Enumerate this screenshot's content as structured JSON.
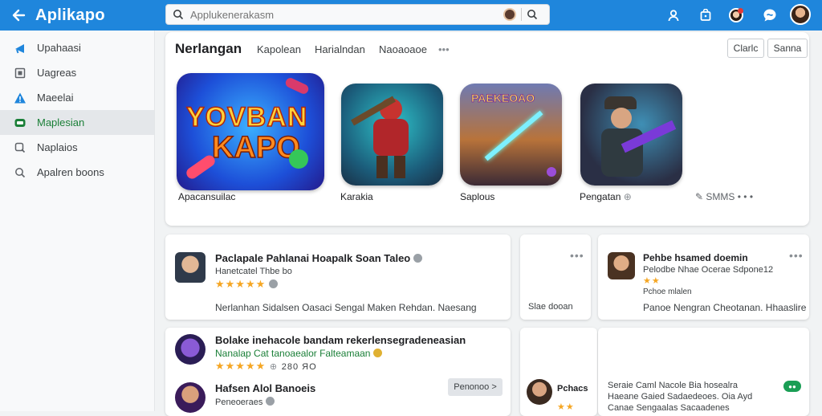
{
  "app": {
    "name": "Aplikapo"
  },
  "search": {
    "placeholder": "Applukenerakasm"
  },
  "sidebar": {
    "items": [
      {
        "label": "Upahaasi"
      },
      {
        "label": "Uagreas"
      },
      {
        "label": "Maeelai"
      },
      {
        "label": "Maplesian"
      },
      {
        "label": "Naplaios"
      },
      {
        "label": "Apalren boons"
      }
    ]
  },
  "featured": {
    "title": "Nerlangan",
    "tabs": [
      "Kapolean",
      "Harialndan",
      "Naoaoaoe"
    ],
    "more": "•••",
    "buttons": {
      "clarke": "Clarlc",
      "sanna": "Sanna"
    },
    "tiles": [
      {
        "label": "Apacansuilac"
      },
      {
        "label": "Karakia"
      },
      {
        "label": "Saplous"
      },
      {
        "label": "Pengatan"
      }
    ],
    "see_more": "SMMS",
    "tile1_text": [
      "YOVBAN",
      "KAPO"
    ],
    "tile3_text": "PAEKEOAO"
  },
  "cards": {
    "card1": {
      "title": "Paclapale Pahlanai Hoapalk Soan Taleo",
      "subtitle": "Hanetcatel Thbe bo",
      "stars": "★★★★★",
      "footer": "Nerlanhan Sidalsen   Oasaci Sengal  Maken Rehdan.   Naesang"
    },
    "card_small": {
      "footer": "Slae dooan"
    },
    "card2": {
      "title": "Pehbe hsamed doemin",
      "subtitle": "Pelodbe Nhae Ocerae Sdpone12",
      "stars": "★★",
      "rating_note": "Pchoe mlalen",
      "footer": "Panoe Nengran Cheotanan.   Hhaaslire"
    },
    "card3": {
      "title": "Bolake inehacole bandam rekerlensegradeneasian",
      "subtitle": "Nanalap Cat tanoaealor Falteamaan",
      "stars": "★★★★★",
      "rating_count": "280 ЯО",
      "title2": "Hafsen Alol Banoeis",
      "subtitle2": "Peneoeraes",
      "button": "Penonoo >"
    },
    "card4": {
      "title": "Pchacs",
      "stars": "★★"
    },
    "card5": {
      "lines": [
        "Seraie   Caml Nacole   Bia hosealra",
        "Haeane   Gaied Sadaedeoes. Oia Ayd",
        "Canae   Sengaalas  Sacaadenes"
      ],
      "badge": "●●"
    }
  },
  "colors": {
    "topbar": "#1f86dc",
    "accent_green": "#1a7f37",
    "star": "#f5a623"
  },
  "icons": [
    "back-arrow-icon",
    "search-icon",
    "account-icon",
    "store-icon",
    "notification-avatar-icon",
    "help-icon"
  ]
}
